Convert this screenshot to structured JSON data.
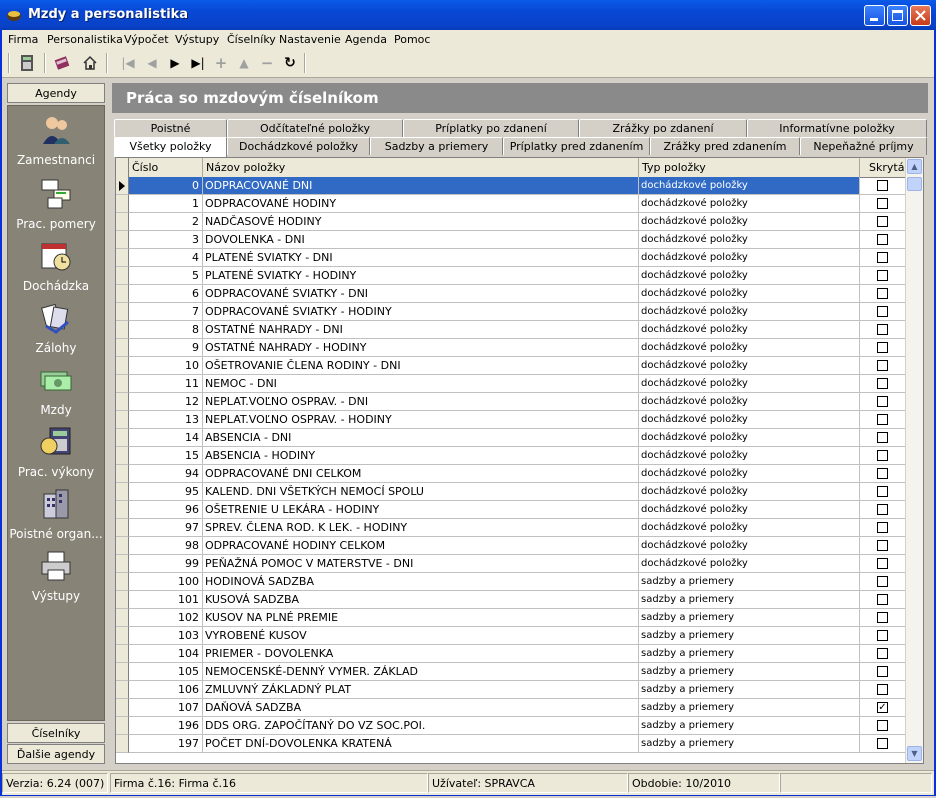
{
  "window": {
    "title": "Mzdy a personalistika"
  },
  "menu": [
    "Firma",
    "Personalistika",
    "Výpočet",
    "Výstupy",
    "Číselníky",
    "Nastavenie",
    "Agenda",
    "Pomoc"
  ],
  "sidebar": {
    "header": "Agendy",
    "items": [
      {
        "label": "Zamestnanci",
        "icon": "employees-icon"
      },
      {
        "label": "Prac. pomery",
        "icon": "work-relations-icon"
      },
      {
        "label": "Dochádzka",
        "icon": "attendance-icon"
      },
      {
        "label": "Zálohy",
        "icon": "advances-icon"
      },
      {
        "label": "Mzdy",
        "icon": "wages-icon"
      },
      {
        "label": "Prac. výkony",
        "icon": "work-output-icon"
      },
      {
        "label": "Poistné organ...",
        "icon": "insurance-org-icon"
      },
      {
        "label": "Výstupy",
        "icon": "printer-icon"
      }
    ],
    "footer1": "Číselníky",
    "footer2": "Ďalšie agendy"
  },
  "page": {
    "title": "Práca so mzdovým číselníkom"
  },
  "tabs_top": [
    "Poistné",
    "Odčítateľné položky",
    "Príplatky po zdanení",
    "Zrážky po zdanení",
    "Informatívne položky"
  ],
  "tabs_bottom": [
    "Všetky položky",
    "Dochádzkové položky",
    "Sadzby a priemery",
    "Príplatky pred zdanením",
    "Zrážky pred zdanením",
    "Nepeňažné príjmy"
  ],
  "grid": {
    "columns": [
      "Číslo položky",
      "Názov položky",
      "Typ položky",
      "Skrytá"
    ],
    "rows": [
      {
        "num": "0",
        "name": "ODPRACOVANÉ DNI",
        "type": "dochádzkové položky",
        "hidden": false
      },
      {
        "num": "1",
        "name": "ODPRACOVANÉ HODINY",
        "type": "dochádzkové položky",
        "hidden": false
      },
      {
        "num": "2",
        "name": "NADČASOVÉ HODINY",
        "type": "dochádzkové položky",
        "hidden": false
      },
      {
        "num": "3",
        "name": "DOVOLENKA - DNI",
        "type": "dochádzkové položky",
        "hidden": false
      },
      {
        "num": "4",
        "name": "PLATENÉ SVIATKY - DNI",
        "type": "dochádzkové položky",
        "hidden": false
      },
      {
        "num": "5",
        "name": "PLATENÉ SVIATKY - HODINY",
        "type": "dochádzkové položky",
        "hidden": false
      },
      {
        "num": "6",
        "name": "ODPRACOVANÉ SVIATKY - DNI",
        "type": "dochádzkové položky",
        "hidden": false
      },
      {
        "num": "7",
        "name": "ODPRACOVANÉ SVIATKY - HODINY",
        "type": "dochádzkové položky",
        "hidden": false
      },
      {
        "num": "8",
        "name": "OSTATNÉ NAHRADY - DNI",
        "type": "dochádzkové položky",
        "hidden": false
      },
      {
        "num": "9",
        "name": "OSTATNÉ NAHRADY - HODINY",
        "type": "dochádzkové položky",
        "hidden": false
      },
      {
        "num": "10",
        "name": "OŠETROVANIE ČLENA RODINY - DNI",
        "type": "dochádzkové položky",
        "hidden": false
      },
      {
        "num": "11",
        "name": "NEMOC - DNI",
        "type": "dochádzkové položky",
        "hidden": false
      },
      {
        "num": "12",
        "name": "NEPLAT.VOĽNO OSPRAV. - DNI",
        "type": "dochádzkové položky",
        "hidden": false
      },
      {
        "num": "13",
        "name": "NEPLAT.VOĽNO OSPRAV. - HODINY",
        "type": "dochádzkové položky",
        "hidden": false
      },
      {
        "num": "14",
        "name": "ABSENCIA - DNI",
        "type": "dochádzkové položky",
        "hidden": false
      },
      {
        "num": "15",
        "name": "ABSENCIA - HODINY",
        "type": "dochádzkové položky",
        "hidden": false
      },
      {
        "num": "94",
        "name": "ODPRACOVANÉ DNI CELKOM",
        "type": "dochádzkové položky",
        "hidden": false
      },
      {
        "num": "95",
        "name": "KALEND. DNI VŠETKÝCH NEMOCÍ SPOLU",
        "type": "dochádzkové položky",
        "hidden": false
      },
      {
        "num": "96",
        "name": "OŠETRENIE U LEKÁRA - HODINY",
        "type": "dochádzkové položky",
        "hidden": false
      },
      {
        "num": "97",
        "name": "SPREV. ČLENA ROD. K LEK. - HODINY",
        "type": "dochádzkové položky",
        "hidden": false
      },
      {
        "num": "98",
        "name": "ODPRACOVANÉ HODINY CELKOM",
        "type": "dochádzkové položky",
        "hidden": false
      },
      {
        "num": "99",
        "name": "PEŇAŽNÁ POMOC V MATERSTVE - DNI",
        "type": "dochádzkové položky",
        "hidden": false
      },
      {
        "num": "100",
        "name": "HODINOVÁ SADZBA",
        "type": "sadzby a priemery",
        "hidden": false
      },
      {
        "num": "101",
        "name": "KUSOVÁ SADZBA",
        "type": "sadzby a priemery",
        "hidden": false
      },
      {
        "num": "102",
        "name": "KUSOV NA PLNÉ PREMIE",
        "type": "sadzby a priemery",
        "hidden": false
      },
      {
        "num": "103",
        "name": "VYROBENÉ KUSOV",
        "type": "sadzby a priemery",
        "hidden": false
      },
      {
        "num": "104",
        "name": "PRIEMER - DOVOLENKA",
        "type": "sadzby a priemery",
        "hidden": false
      },
      {
        "num": "105",
        "name": "NEMOCENSKÉ-DENNÝ VYMER. ZÁKLAD",
        "type": "sadzby a priemery",
        "hidden": false
      },
      {
        "num": "106",
        "name": "ZMLUVNÝ ZÁKLADNÝ PLAT",
        "type": "sadzby a priemery",
        "hidden": false
      },
      {
        "num": "107",
        "name": "DAŇOVÁ SADZBA",
        "type": "sadzby a priemery",
        "hidden": true
      },
      {
        "num": "196",
        "name": "DDS ORG.  ZAPOČÍTANÝ DO VZ SOC.POI.",
        "type": "sadzby a priemery",
        "hidden": false
      },
      {
        "num": "197",
        "name": "POČET DNÍ-DOVOLENKA KRATENÁ",
        "type": "sadzby a priemery",
        "hidden": false
      }
    ]
  },
  "status": {
    "version": "Verzia: 6.24 (007)",
    "firm": "Firma č.16: Firma č.16",
    "user": "Užívateľ: SPRAVCA",
    "period": "Obdobie: 10/2010"
  }
}
